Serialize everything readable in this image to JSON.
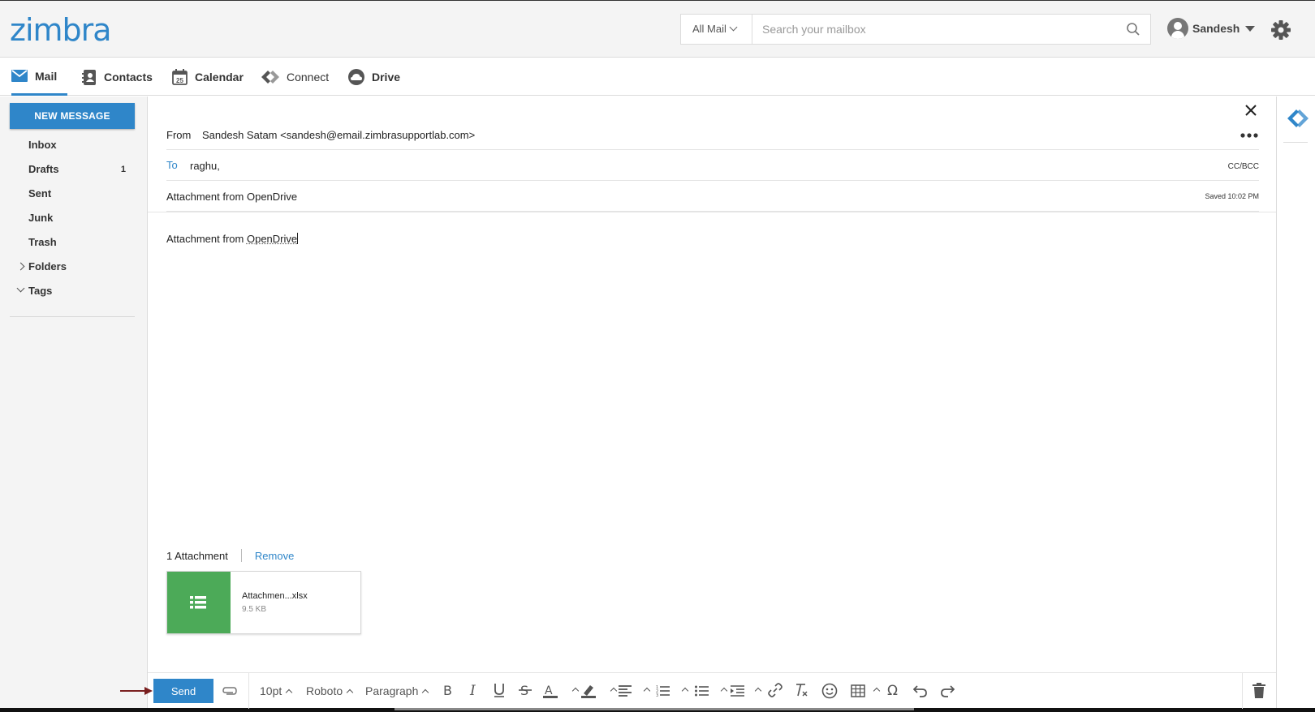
{
  "header": {
    "logo": "zimbra",
    "search_scope": "All Mail",
    "search_placeholder": "Search your mailbox",
    "user_name": "Sandesh"
  },
  "nav": {
    "tabs": [
      {
        "label": "Mail",
        "icon": "mail-icon",
        "active": true
      },
      {
        "label": "Contacts",
        "icon": "contacts-icon"
      },
      {
        "label": "Calendar",
        "icon": "calendar-icon",
        "icon_text": "25"
      },
      {
        "label": "Connect",
        "icon": "connect-icon"
      },
      {
        "label": "Drive",
        "icon": "cloud-icon"
      }
    ]
  },
  "sidebar": {
    "new_message": "NEW MESSAGE",
    "folders": [
      {
        "label": "Inbox"
      },
      {
        "label": "Drafts",
        "count": "1"
      },
      {
        "label": "Sent"
      },
      {
        "label": "Junk"
      },
      {
        "label": "Trash"
      },
      {
        "label": "Folders",
        "expander": "collapsed"
      },
      {
        "label": "Tags",
        "expander": "expanded"
      }
    ]
  },
  "compose": {
    "from_label": "From",
    "from_value": "Sandesh Satam <sandesh@email.zimbrasupportlab.com>",
    "to_label": "To",
    "to_value": "raghu,",
    "cc_bcc": "CC/BCC",
    "subject": "Attachment from OpenDrive",
    "saved": "Saved 10:02 PM",
    "body_prefix": "Attachment from ",
    "body_word": "OpenDrive",
    "attachment_count": "1 Attachment",
    "remove": "Remove",
    "attachment": {
      "name": "Attachmen...xlsx",
      "size": "9.5 KB"
    }
  },
  "toolbar": {
    "send": "Send",
    "font_size": "10pt",
    "font_family": "Roboto",
    "block_format": "Paragraph"
  },
  "colors": {
    "accent": "#2f86c9",
    "attachment_thumb": "#4caa58",
    "sidebar_bg": "#f4f4f4",
    "arrow_mark": "#7a2020"
  }
}
